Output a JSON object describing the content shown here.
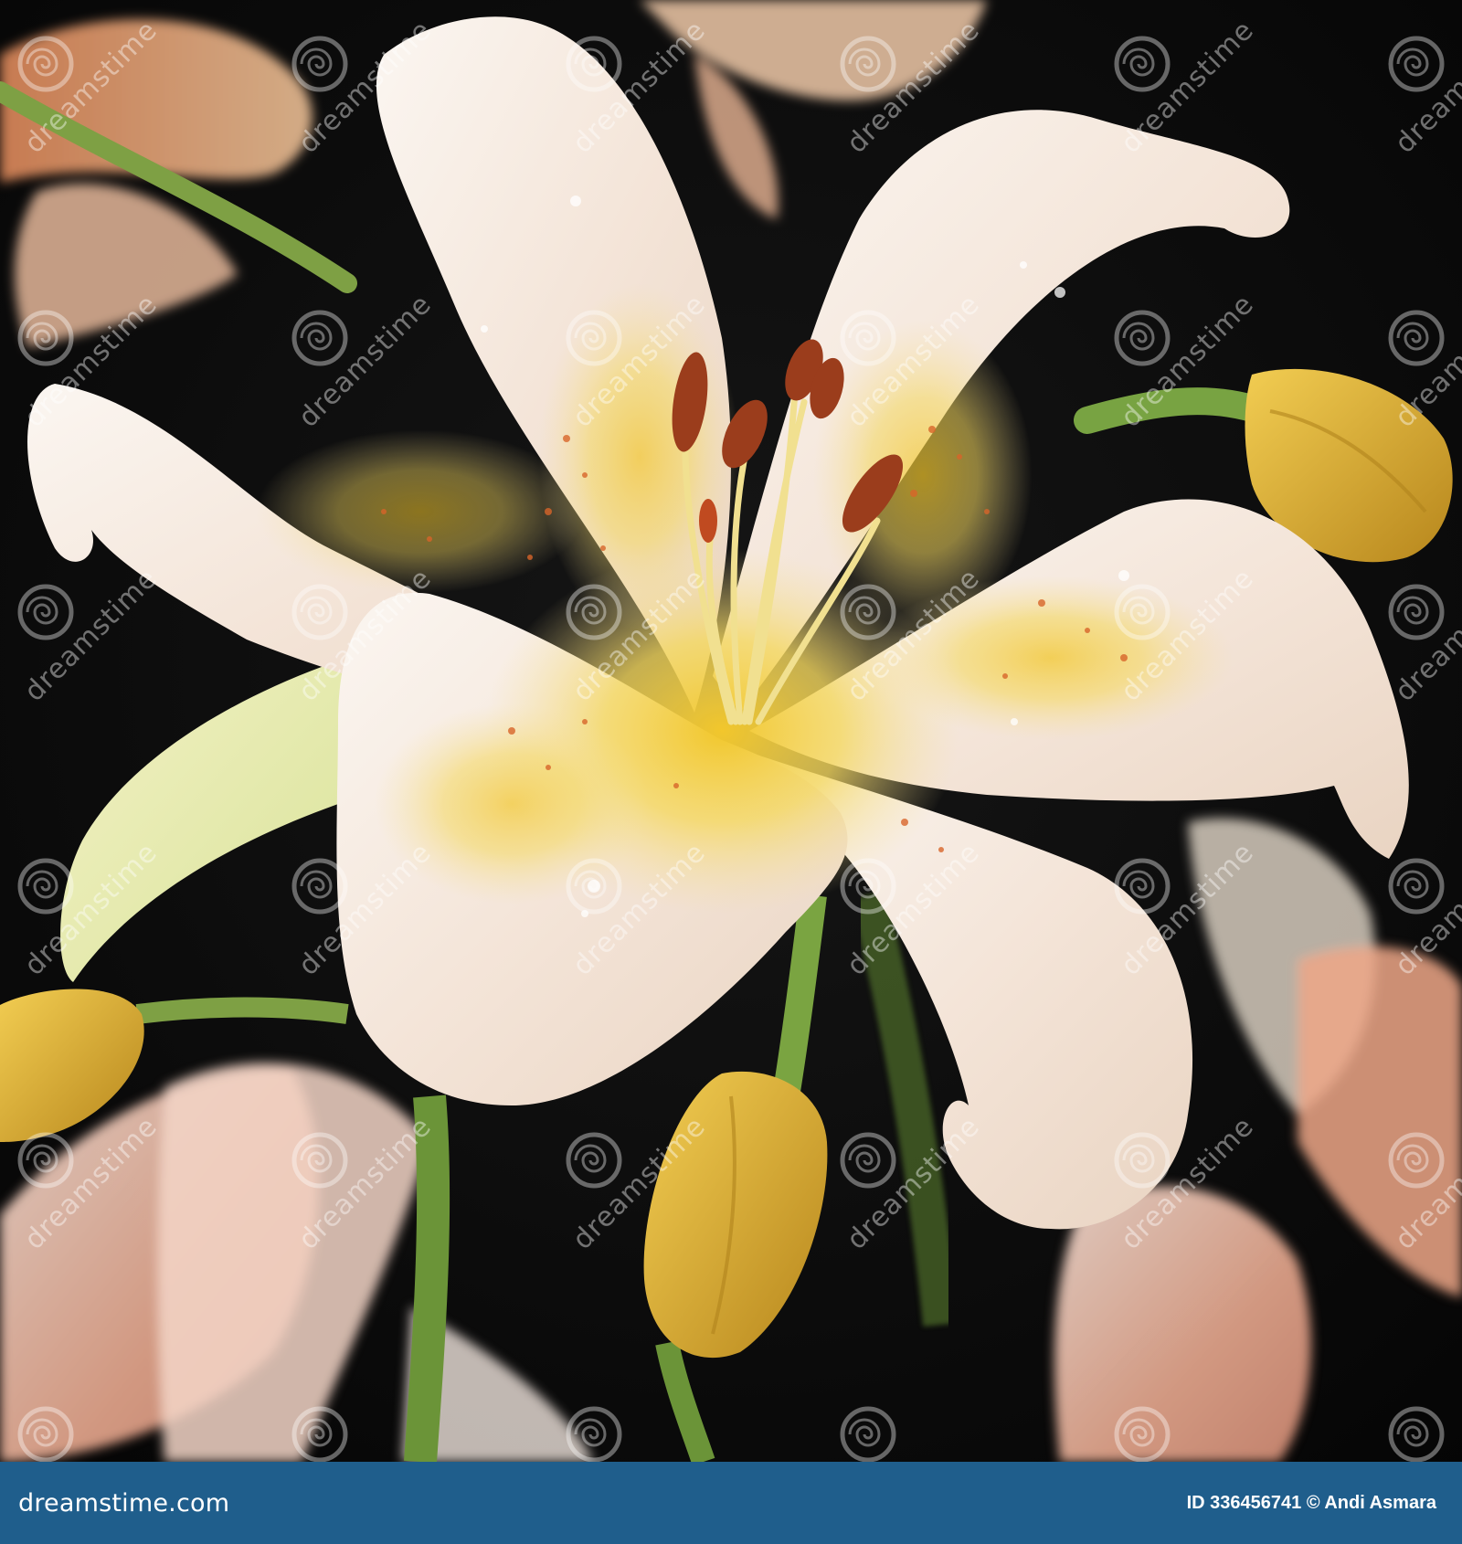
{
  "photo": {
    "subject": "lily-flower",
    "watermark_text": "dreamstime"
  },
  "footer": {
    "logo": "dreamstime.com",
    "image_id": "ID 336456741 © Andi  Asmara"
  },
  "colors": {
    "background": "#0e0e0e",
    "petal": "#f7ede4",
    "throat": "#f1cf2e",
    "anther": "#9b3d1c",
    "stem": "#6f9a3a",
    "bud": "#d9a72e",
    "footer": "#1f5e8c"
  }
}
